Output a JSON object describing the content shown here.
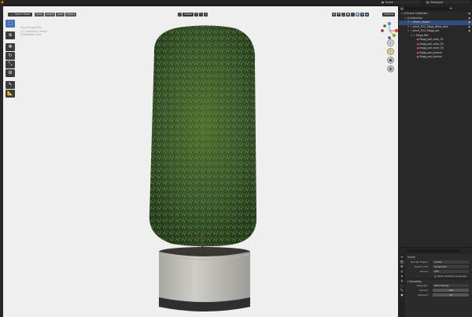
{
  "topbar": {
    "logo": "blender-logo",
    "scene_name": "Scene",
    "view_layer": "ViewLayer"
  },
  "viewport": {
    "mode": "Object Mode",
    "menus": [
      "View",
      "Select",
      "Add",
      "Object"
    ],
    "transform_orientation": "Global",
    "options_label": "Options",
    "overlay_lines": [
      "User Perspective",
      "(1) Collection | Shape",
      "Subdivision level"
    ]
  },
  "toolbar": {
    "tools": [
      "select-box-icon",
      "cursor-icon",
      "move-icon",
      "rotate-icon",
      "scale-icon",
      "transform-icon",
      "annotate-icon",
      "measure-icon"
    ]
  },
  "outliner": {
    "title": "Scene Collection",
    "rows": [
      {
        "label": "Scene Collection",
        "icon": "▤",
        "color": "gray",
        "indent": 0,
        "selected": false
      },
      {
        "label": "Collection",
        "icon": "▤",
        "color": "gray",
        "indent": 1,
        "selected": false
      },
      {
        "label": "Decor_Object",
        "icon": "▽",
        "color": "orange",
        "indent": 2,
        "selected": true
      },
      {
        "label": "plant_R12_Slagg_8Rod_kate",
        "icon": "▽",
        "color": "orange",
        "indent": 2,
        "selected": false
      },
      {
        "label": "plant_R12_Slagg_pot",
        "icon": "▽",
        "color": "orange",
        "indent": 2,
        "selected": false
      },
      {
        "label": "Mega-Min",
        "icon": "▽",
        "color": "green",
        "indent": 3,
        "selected": false
      },
      {
        "label": "Slagg_pot_color_01",
        "icon": "●",
        "color": "red",
        "indent": 4,
        "selected": false
      },
      {
        "label": "Slagg_pot_color_02",
        "icon": "●",
        "color": "red",
        "indent": 4,
        "selected": false
      },
      {
        "label": "Slagg_pot_color_03",
        "icon": "●",
        "color": "red",
        "indent": 4,
        "selected": false
      },
      {
        "label": "Slagg_pot_ground",
        "icon": "●",
        "color": "red",
        "indent": 4,
        "selected": false
      },
      {
        "label": "Slagg_pot_plantss",
        "icon": "●",
        "color": "red",
        "indent": 4,
        "selected": false
      }
    ]
  },
  "properties": {
    "title": "Scene",
    "render_engine_label": "Render Engine",
    "render_engine": "Cycles",
    "feature_set_label": "Feature Set",
    "feature_set": "Supported",
    "device_label": "Device",
    "device": "CPU",
    "checkbox_label": "Open Shading Language",
    "sampling_section": "Sampling",
    "integrator_label": "Integrator",
    "integrator": "Path Tracing",
    "render_label": "Render",
    "render_value": "128",
    "viewport_label": "Viewport",
    "viewport_value": "32"
  }
}
